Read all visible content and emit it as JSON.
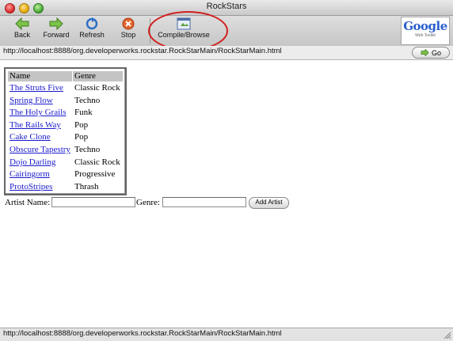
{
  "window": {
    "title": "RockStars"
  },
  "toolbar": {
    "back_label": "Back",
    "forward_label": "Forward",
    "refresh_label": "Refresh",
    "stop_label": "Stop",
    "compile_label": "Compile/Browse",
    "google_logo": "Google",
    "google_sub": "Web Toolkit"
  },
  "address": {
    "url": "http://localhost:8888/org.developerworks.rockstar.RockStarMain/RockStarMain.html",
    "go_label": "Go"
  },
  "grid": {
    "headers": [
      "Name",
      "Genre"
    ],
    "rows": [
      {
        "name": "The Struts Five",
        "genre": "Classic Rock"
      },
      {
        "name": "Spring Flow",
        "genre": "Techno"
      },
      {
        "name": "The Holy Grails",
        "genre": "Funk"
      },
      {
        "name": "The Rails Way",
        "genre": "Pop"
      },
      {
        "name": "Cake Clone",
        "genre": "Pop"
      },
      {
        "name": "Obscure Tapestry",
        "genre": "Techno"
      },
      {
        "name": "Dojo Darling",
        "genre": "Classic Rock"
      },
      {
        "name": "Cairingorm",
        "genre": "Progressive"
      },
      {
        "name": "ProtoStripes",
        "genre": "Thrash"
      }
    ]
  },
  "form": {
    "artist_label": "Artist Name:",
    "artist_value": "",
    "genre_label": "Genre:",
    "genre_value": "",
    "add_label": "Add Artist"
  },
  "status": {
    "text": "http://localhost:8888/org.developerworks.rockstar.RockStarMain/RockStarMain.html"
  },
  "colors": {
    "link": "#1a1acc",
    "annotation": "#d21f1f",
    "header_bg": "#c4c4c4"
  }
}
